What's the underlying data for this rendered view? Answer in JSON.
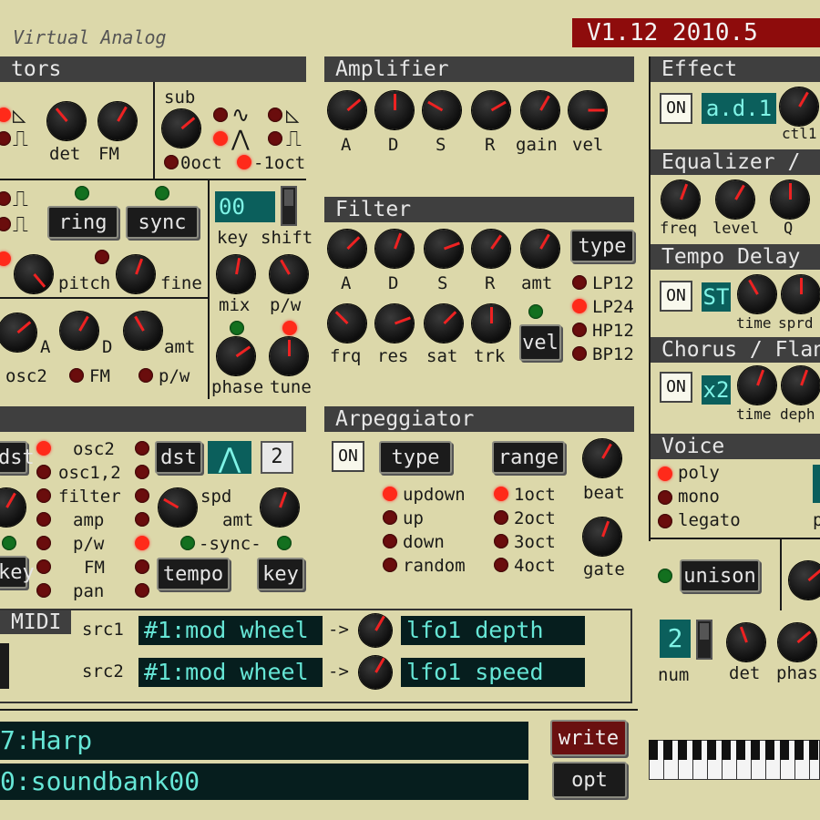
{
  "app": {
    "title": "Virtual Analog",
    "version": "V1.12 2010.5"
  },
  "headers": {
    "oscillators": "tors",
    "amplifier": "Amplifier",
    "filter": "Filter",
    "effect": "Effect",
    "equalizer": "Equalizer / ",
    "tempo_delay": "Tempo Delay",
    "chorus": "Chorus / Flan",
    "arpeggiator": "Arpeggiator",
    "voice": "Voice",
    "midi": "MIDI"
  },
  "osc": {
    "det": "det",
    "fm": "FM",
    "sub": "sub",
    "oct0": "0oct",
    "oct1": "-1oct",
    "ring": "ring",
    "sync": "sync",
    "pitch": "pitch",
    "fine": "fine",
    "key_value": "00",
    "key": "key",
    "shift": "shift",
    "mix": "mix",
    "pw": "p/w",
    "env_a": "A",
    "env_d": "D",
    "amt": "amt",
    "osc2": "osc2",
    "fm2": "FM",
    "pw2": "p/w",
    "phase": "phase",
    "tune": "tune"
  },
  "amp": {
    "labels": [
      "A",
      "D",
      "S",
      "R",
      "gain",
      "vel"
    ]
  },
  "filter": {
    "labels1": [
      "A",
      "D",
      "S",
      "R",
      "amt"
    ],
    "labels2": [
      "frq",
      "res",
      "sat",
      "trk"
    ],
    "type_button": "type",
    "vel_button": "vel",
    "types": [
      "LP12",
      "LP24",
      "HP12",
      "BP12"
    ]
  },
  "effect": {
    "on": "ON",
    "preset": "a.d.1",
    "ctl": "ctl1"
  },
  "eq": {
    "labels": [
      "freq",
      "level",
      "Q"
    ]
  },
  "delay": {
    "on": "ON",
    "mode": "ST",
    "time": "time",
    "sprd": "sprd"
  },
  "chorus": {
    "on": "ON",
    "mode": "x2",
    "time": "time",
    "depth": "deph"
  },
  "lfo": {
    "dst1": "dst",
    "targets": [
      "osc2",
      "osc1,2",
      "filter",
      "amp",
      "p/w",
      "FM",
      "pan"
    ],
    "key1": "key",
    "dst2": "dst",
    "num": "2",
    "spd": "spd",
    "amt": "amt",
    "sync": "-sync-",
    "tempo": "tempo",
    "key2": "key"
  },
  "arp": {
    "on": "ON",
    "type": "type",
    "range": "range",
    "modes": [
      "updown",
      "up",
      "down",
      "random"
    ],
    "octaves": [
      "1oct",
      "2oct",
      "3oct",
      "4oct"
    ],
    "beat": "beat",
    "gate": "gate"
  },
  "voice": {
    "modes": [
      "poly",
      "mono",
      "legato"
    ],
    "p": "p",
    "unison": "unison",
    "num_value": "2",
    "num": "num",
    "det": "det",
    "phase": "phas"
  },
  "midi": {
    "src1_label": "src1",
    "src1_value": "#1:mod wheel",
    "arrow1": "->",
    "dst1_value": "lfo1 depth",
    "src2_label": "src2",
    "src2_value": "#1:mod wheel",
    "arrow2": "->",
    "dst2_value": "lfo1 speed"
  },
  "patch": {
    "name": "7:Harp",
    "bank": "0:soundbank00",
    "write": "write",
    "opt": "opt"
  }
}
